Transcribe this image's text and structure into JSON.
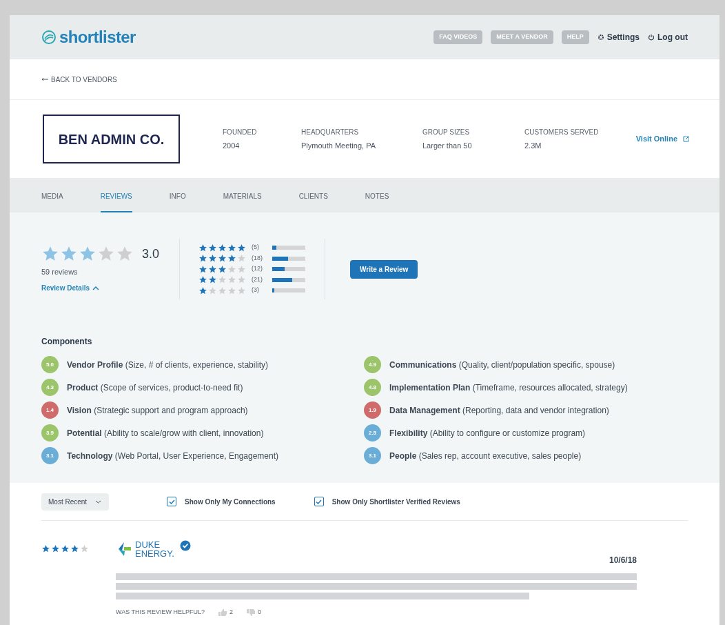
{
  "header": {
    "logo": "shortlister",
    "nav_buttons": [
      "FAQ VIDEOS",
      "MEET A VENDOR",
      "HELP"
    ],
    "settings": "Settings",
    "logout": "Log out"
  },
  "back_link": "BACK TO VENDORS",
  "vendor": {
    "logo_text": "BEN ADMIN CO.",
    "facts": [
      {
        "label": "FOUNDED",
        "value": "2004"
      },
      {
        "label": "HEADQUARTERS",
        "value": "Plymouth Meeting, PA"
      },
      {
        "label": "GROUP SIZES",
        "value": "Larger than 50"
      },
      {
        "label": "CUSTOMERS SERVED",
        "value": "2.3M"
      }
    ],
    "visit_link": "Visit Online"
  },
  "tabs": [
    {
      "label": "MEDIA",
      "selected": false
    },
    {
      "label": "REVIEWS",
      "selected": true
    },
    {
      "label": "INFO",
      "selected": false
    },
    {
      "label": "MATERIALS",
      "selected": false
    },
    {
      "label": "CLIENTS",
      "selected": false
    },
    {
      "label": "NOTES",
      "selected": false
    }
  ],
  "summary": {
    "stars": 3,
    "score": "3.0",
    "count": "59 reviews",
    "details_link": "Review Details",
    "expanded": true,
    "distribution": [
      {
        "stars": 5,
        "count": "(5)",
        "level": 0.12
      },
      {
        "stars": 4,
        "count": "(18)",
        "level": 0.47
      },
      {
        "stars": 3,
        "count": "(12)",
        "level": 0.37
      },
      {
        "stars": 2,
        "count": "(21)",
        "level": 0.6
      },
      {
        "stars": 1,
        "count": "(3)",
        "level": 0.07
      }
    ],
    "write_button": "Write a Review"
  },
  "components": {
    "title": "Components",
    "items": [
      {
        "score": "5.0",
        "color": "#9cc46b",
        "name": "Vendor Profile",
        "detail": "(Size, # of clients, experience, stability)"
      },
      {
        "score": "4.3",
        "color": "#9cc46b",
        "name": "Product",
        "detail": "(Scope of services, product-to-need fit)"
      },
      {
        "score": "1.4",
        "color": "#d06b6b",
        "name": "Vision",
        "detail": "(Strategic support and program approach)"
      },
      {
        "score": "3.9",
        "color": "#9cc46b",
        "name": "Potential",
        "detail": "(Ability to scale/grow with client, innovation)"
      },
      {
        "score": "3.1",
        "color": "#6aaed8",
        "name": "Technology",
        "detail": "(Web Portal, User Experience, Engagement)"
      },
      {
        "score": "4.9",
        "color": "#9cc46b",
        "name": "Communications",
        "detail": "(Quality, client/population specific, spouse)"
      },
      {
        "score": "4.8",
        "color": "#9cc46b",
        "name": "Implementation Plan",
        "detail": "(Timeframe, resources allocated, strategy)"
      },
      {
        "score": "1.9",
        "color": "#d06b6b",
        "name": "Data Management",
        "detail": "(Reporting, data and vendor integration)"
      },
      {
        "score": "2.5",
        "color": "#6aaed8",
        "name": "Flexibility",
        "detail": "(Ability to configure or customize program)"
      },
      {
        "score": "3.1",
        "color": "#6aaed8",
        "name": "People",
        "detail": "(Sales rep, account executive, sales people)"
      }
    ]
  },
  "filters": {
    "sort": "Most Recent",
    "checkboxes": [
      {
        "label": "Show Only My Connections",
        "checked": true
      },
      {
        "label": "Show Only Shortlister Verified Reviews",
        "checked": true
      }
    ]
  },
  "review": {
    "stars": 4,
    "company": [
      "DUKE",
      "ENERGY."
    ],
    "verified": true,
    "date": "10/6/18",
    "helpful_label": "WAS THIS REVIEW HELPFUL?",
    "up": "2",
    "down": "0"
  }
}
